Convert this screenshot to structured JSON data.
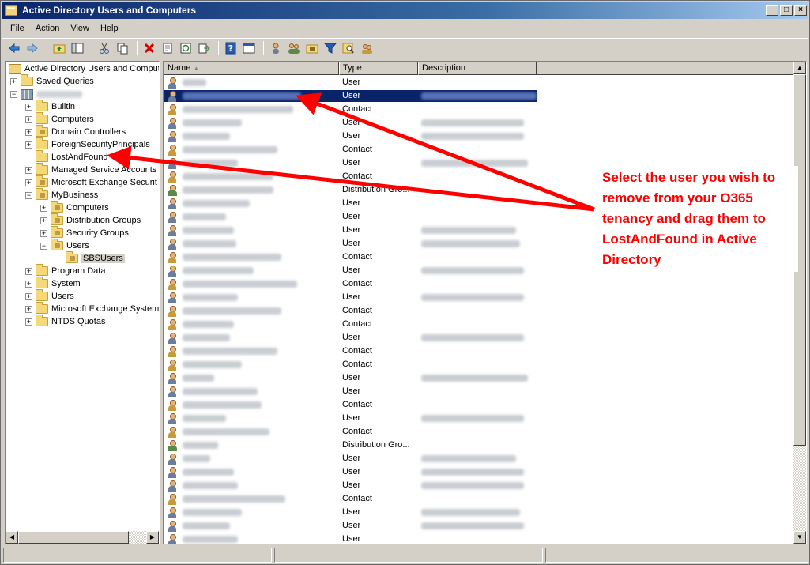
{
  "window": {
    "title": "Active Directory Users and Computers",
    "min_label": "_",
    "max_label": "□",
    "close_label": "×"
  },
  "menu": {
    "items": [
      "File",
      "Action",
      "View",
      "Help"
    ]
  },
  "toolbar": {
    "icons": [
      "back-arrow-icon",
      "forward-arrow-icon",
      "up-folder-icon",
      "show-tree-icon",
      "cut-icon",
      "copy-icon",
      "delete-icon",
      "properties-icon",
      "refresh-icon",
      "export-icon",
      "help-icon",
      "console-icon",
      "new-user-icon",
      "new-group-icon",
      "new-ou-icon",
      "filter-icon",
      "find-icon",
      "add-to-group-icon"
    ]
  },
  "tree": {
    "root": "Active Directory Users and Comput",
    "saved_queries": "Saved Queries",
    "items": [
      {
        "label": "Builtin",
        "level": 2,
        "expander": "+",
        "type": "folder"
      },
      {
        "label": "Computers",
        "level": 2,
        "expander": "+",
        "type": "folder"
      },
      {
        "label": "Domain Controllers",
        "level": 2,
        "expander": "+",
        "type": "ou"
      },
      {
        "label": "ForeignSecurityPrincipals",
        "level": 2,
        "expander": "+",
        "type": "folder"
      },
      {
        "label": "LostAndFound",
        "level": 2,
        "expander": "",
        "type": "folder"
      },
      {
        "label": "Managed Service Accounts",
        "level": 2,
        "expander": "+",
        "type": "folder"
      },
      {
        "label": "Microsoft Exchange Securit",
        "level": 2,
        "expander": "+",
        "type": "ou"
      },
      {
        "label": "MyBusiness",
        "level": 2,
        "expander": "−",
        "type": "ou"
      },
      {
        "label": "Computers",
        "level": 3,
        "expander": "+",
        "type": "ou"
      },
      {
        "label": "Distribution Groups",
        "level": 3,
        "expander": "+",
        "type": "ou"
      },
      {
        "label": "Security Groups",
        "level": 3,
        "expander": "+",
        "type": "ou"
      },
      {
        "label": "Users",
        "level": 3,
        "expander": "−",
        "type": "ou"
      },
      {
        "label": "SBSUsers",
        "level": 4,
        "expander": "",
        "type": "ou",
        "selected": true
      },
      {
        "label": "Program Data",
        "level": 2,
        "expander": "+",
        "type": "folder"
      },
      {
        "label": "System",
        "level": 2,
        "expander": "+",
        "type": "folder"
      },
      {
        "label": "Users",
        "level": 2,
        "expander": "+",
        "type": "folder"
      },
      {
        "label": "Microsoft Exchange System",
        "level": 2,
        "expander": "+",
        "type": "folder"
      },
      {
        "label": "NTDS Quotas",
        "level": 2,
        "expander": "+",
        "type": "folder"
      }
    ]
  },
  "list": {
    "columns": {
      "name": "Name",
      "type": "Type",
      "description": "Description"
    },
    "rows": [
      {
        "type": "User",
        "nw": 30,
        "dw": 0
      },
      {
        "type": "User",
        "nw": 150,
        "dw": 150,
        "selected": true
      },
      {
        "type": "Contact",
        "nw": 140,
        "dw": 0
      },
      {
        "type": "User",
        "nw": 75,
        "dw": 130
      },
      {
        "type": "User",
        "nw": 60,
        "dw": 130
      },
      {
        "type": "Contact",
        "nw": 120,
        "dw": 0
      },
      {
        "type": "User",
        "nw": 70,
        "dw": 135
      },
      {
        "type": "Contact",
        "nw": 115,
        "dw": 0
      },
      {
        "type": "Distribution Gro...",
        "nw": 115,
        "dw": 0
      },
      {
        "type": "User",
        "nw": 85,
        "dw": 0
      },
      {
        "type": "User",
        "nw": 55,
        "dw": 0
      },
      {
        "type": "User",
        "nw": 65,
        "dw": 120
      },
      {
        "type": "User",
        "nw": 68,
        "dw": 125
      },
      {
        "type": "Contact",
        "nw": 125,
        "dw": 0
      },
      {
        "type": "User",
        "nw": 90,
        "dw": 130
      },
      {
        "type": "Contact",
        "nw": 145,
        "dw": 0
      },
      {
        "type": "User",
        "nw": 70,
        "dw": 130
      },
      {
        "type": "Contact",
        "nw": 125,
        "dw": 0
      },
      {
        "type": "Contact",
        "nw": 65,
        "dw": 0
      },
      {
        "type": "User",
        "nw": 60,
        "dw": 130
      },
      {
        "type": "Contact",
        "nw": 120,
        "dw": 0
      },
      {
        "type": "Contact",
        "nw": 75,
        "dw": 0
      },
      {
        "type": "User",
        "nw": 40,
        "dw": 135
      },
      {
        "type": "User",
        "nw": 95,
        "dw": 0
      },
      {
        "type": "Contact",
        "nw": 100,
        "dw": 0
      },
      {
        "type": "User",
        "nw": 55,
        "dw": 130
      },
      {
        "type": "Contact",
        "nw": 110,
        "dw": 0
      },
      {
        "type": "Distribution Gro...",
        "nw": 45,
        "dw": 0
      },
      {
        "type": "User",
        "nw": 35,
        "dw": 120
      },
      {
        "type": "User",
        "nw": 65,
        "dw": 130
      },
      {
        "type": "User",
        "nw": 70,
        "dw": 130
      },
      {
        "type": "Contact",
        "nw": 130,
        "dw": 0
      },
      {
        "type": "User",
        "nw": 75,
        "dw": 125
      },
      {
        "type": "User",
        "nw": 60,
        "dw": 130
      },
      {
        "type": "User",
        "nw": 70,
        "dw": 0
      }
    ]
  },
  "annotation": {
    "text": "Select the user you wish to remove from your O365 tenancy and drag them to LostAndFound in Active Directory",
    "color": "#ff0000"
  }
}
